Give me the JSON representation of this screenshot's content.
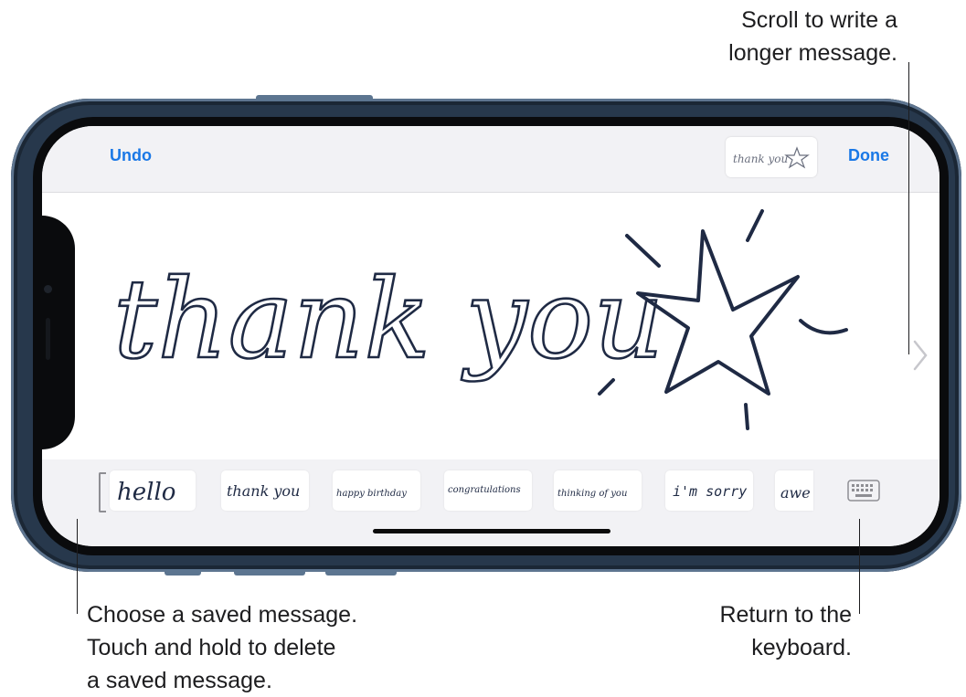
{
  "callouts": {
    "scroll": [
      "Scroll to write a",
      "longer message."
    ],
    "saved": [
      "Choose a saved message.",
      "Touch and hold to delete",
      "a saved message."
    ],
    "keyboard": [
      "Return to the",
      "keyboard."
    ]
  },
  "toolbar": {
    "undo_label": "Undo",
    "done_label": "Done",
    "preview_text": "thank you"
  },
  "canvas": {
    "handwritten_text": "thank you"
  },
  "saved_messages": [
    "hello",
    "thank you",
    "happy birthday",
    "congratulations",
    "thinking of you",
    "i'm sorry",
    "awe"
  ],
  "icons": {
    "scroll": "chevron-right-icon",
    "keyboard": "keyboard-icon",
    "star": "star-doodle-icon"
  },
  "colors": {
    "accent": "#1a78e6",
    "ink": "#1f2a44",
    "device_frame": "#27384c"
  }
}
